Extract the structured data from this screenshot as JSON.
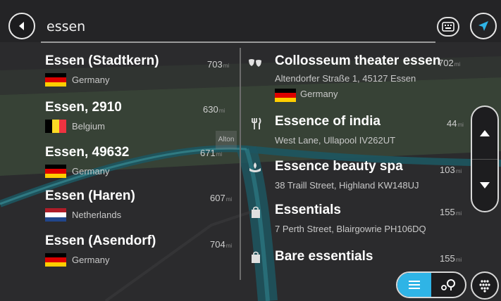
{
  "search": {
    "query": "essen"
  },
  "map": {
    "label": "Alton"
  },
  "left_results": [
    {
      "title": "Essen (Stadtkern)",
      "country": "Germany",
      "flag": "germany",
      "distance": "703",
      "unit": "mi"
    },
    {
      "title": "Essen, 2910",
      "country": "Belgium",
      "flag": "belgium",
      "distance": "630",
      "unit": "mi"
    },
    {
      "title": "Essen, 49632",
      "country": "Germany",
      "flag": "germany",
      "distance": "671",
      "unit": "mi"
    },
    {
      "title": "Essen (Haren)",
      "country": "Netherlands",
      "flag": "netherlands",
      "distance": "607",
      "unit": "mi"
    },
    {
      "title": "Essen (Asendorf)",
      "country": "Germany",
      "flag": "germany",
      "distance": "704",
      "unit": "mi"
    }
  ],
  "right_results": [
    {
      "title": "Collosseum theater essen",
      "address": "Altendorfer Straße 1, 45127 Essen",
      "country": "Germany",
      "flag": "germany",
      "icon": "theater-masks-icon",
      "distance": "702",
      "unit": "mi"
    },
    {
      "title": "Essence of india",
      "address": "West Lane, Ullapool IV262UT",
      "icon": "restaurant-icon",
      "distance": "44",
      "unit": "mi"
    },
    {
      "title": "Essence beauty spa",
      "address": "38 Traill Street, Highland KW148UJ",
      "icon": "spa-icon",
      "distance": "103",
      "unit": "mi"
    },
    {
      "title": "Essentials",
      "address": "7 Perth Street, Blairgowrie PH106DQ",
      "icon": "shopping-bag-icon",
      "distance": "155",
      "unit": "mi"
    },
    {
      "title": "Bare essentials",
      "address": "",
      "icon": "shopping-bag-icon",
      "distance": "155",
      "unit": "mi"
    }
  ],
  "colors": {
    "accent": "#2fb4e6",
    "background": "#2a2a2c",
    "map_green": "#3d4a3a",
    "route_teal": "#1d5660",
    "germany": [
      "#000000",
      "#dd0000",
      "#ffce00"
    ],
    "belgium": [
      "#000000",
      "#fdda24",
      "#ef3340"
    ],
    "netherlands": [
      "#ae1c28",
      "#ffffff",
      "#21468b"
    ]
  },
  "icons": {
    "back": "back-arrow-icon",
    "keyboard": "keyboard-icon",
    "navigate": "navigation-arrow-icon",
    "scroll_up": "chevron-up-icon",
    "scroll_down": "chevron-down-icon",
    "list_view": "list-view-icon",
    "map_view": "map-view-icon",
    "main_menu": "main-menu-icon"
  }
}
